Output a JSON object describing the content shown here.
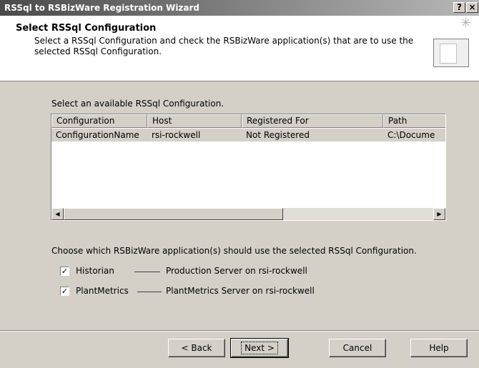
{
  "window": {
    "title": "RSSql to RSBizWare Registration Wizard",
    "help_button": "?",
    "close_button": "×"
  },
  "header": {
    "title": "Select RSSql Configuration",
    "description": "Select a RSSql Configuration and check the RSBizWare application(s) that are to use the selected RSSql Configuration."
  },
  "config_section": {
    "label": "Select an available RSSql Configuration.",
    "columns": [
      "Configuration",
      "Host",
      "Registered For",
      "Path"
    ],
    "rows": [
      [
        "ConfigurationName",
        "rsi-rockwell",
        "Not Registered",
        "C:\\Docume"
      ]
    ]
  },
  "apps_section": {
    "label": "Choose which RSBizWare application(s) should use the selected RSSql Configuration.",
    "apps": [
      {
        "name": "Historian",
        "checked": true,
        "description": "Production Server on rsi-rockwell"
      },
      {
        "name": "PlantMetrics",
        "checked": true,
        "description": "PlantMetrics Server on rsi-rockwell"
      }
    ]
  },
  "buttons": {
    "back": "< Back",
    "next": "Next >",
    "cancel": "Cancel",
    "help": "Help"
  }
}
